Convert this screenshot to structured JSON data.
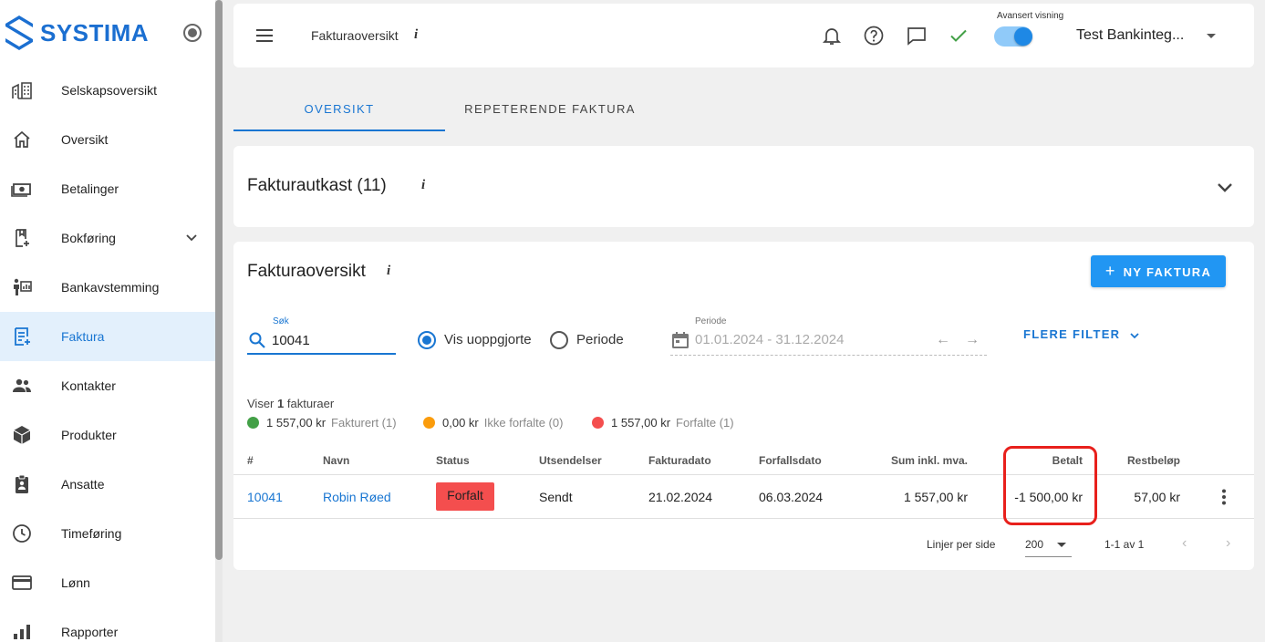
{
  "app": {
    "logo_text": "SYSTIMA"
  },
  "sidebar": {
    "items": [
      {
        "label": "Selskapsoversikt",
        "icon": "company-overview-icon"
      },
      {
        "label": "Oversikt",
        "icon": "home-icon"
      },
      {
        "label": "Betalinger",
        "icon": "payments-icon"
      },
      {
        "label": "Bokføring",
        "icon": "bookkeeping-icon",
        "expandable": true
      },
      {
        "label": "Bankavstemming",
        "icon": "bank-reconciliation-icon"
      },
      {
        "label": "Faktura",
        "icon": "invoice-icon",
        "active": true
      },
      {
        "label": "Kontakter",
        "icon": "contacts-icon"
      },
      {
        "label": "Produkter",
        "icon": "products-icon"
      },
      {
        "label": "Ansatte",
        "icon": "employees-icon"
      },
      {
        "label": "Timeføring",
        "icon": "clock-icon"
      },
      {
        "label": "Lønn",
        "icon": "payroll-card-icon"
      },
      {
        "label": "Rapporter",
        "icon": "reports-icon"
      }
    ]
  },
  "header": {
    "crumb": "Fakturaoversikt",
    "info": "i",
    "advanced_label": "Avansert visning",
    "advanced_on": true,
    "company": "Test Bankinteg..."
  },
  "tabs": [
    {
      "label": "OVERSIKT",
      "active": true
    },
    {
      "label": "REPETERENDE FAKTURA",
      "active": false
    }
  ],
  "drafts": {
    "title": "Fakturautkast (11)",
    "info": "i"
  },
  "overview": {
    "title": "Fakturaoversikt",
    "info": "i",
    "new_button": "NY FAKTURA",
    "search_label": "Søk",
    "search_value": "10041",
    "radio_unsettled": "Vis uoppgjorte",
    "radio_period": "Periode",
    "period_label": "Periode",
    "period_value": "01.01.2024 - 31.12.2024",
    "more_filters": "FLERE FILTER",
    "showing_prefix": "Viser",
    "showing_count": "1",
    "showing_suffix": "fakturaer",
    "legend": [
      {
        "amount": "1 557,00 kr",
        "label": "Fakturert (1)",
        "color": "#43a047"
      },
      {
        "amount": "0,00 kr",
        "label": "Ikke forfalte (0)",
        "color": "#fb9c0c"
      },
      {
        "amount": "1 557,00 kr",
        "label": "Forfalte (1)",
        "color": "#f44e4e"
      }
    ],
    "columns": [
      "#",
      "Navn",
      "Status",
      "Utsendelser",
      "Fakturadato",
      "Forfallsdato",
      "Sum inkl. mva.",
      "Betalt",
      "Restbeløp"
    ],
    "rows": [
      {
        "number": "10041",
        "name": "Robin Røed",
        "status": "Forfalt",
        "dispatch": "Sendt",
        "invoice_date": "21.02.2024",
        "due_date": "06.03.2024",
        "sum": "1 557,00 kr",
        "paid": "-1 500,00 kr",
        "remaining": "57,00 kr"
      }
    ],
    "footer": {
      "lines_label": "Linjer per side",
      "lines_value": "200",
      "range": "1-1 av 1"
    },
    "status_color": "#f44e4e",
    "accent": "#1976d2"
  }
}
